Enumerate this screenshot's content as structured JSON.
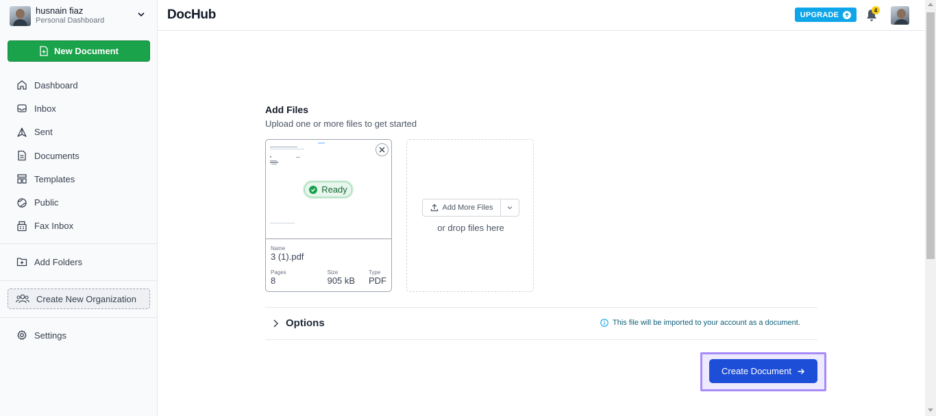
{
  "profile": {
    "name": "husnain fiaz",
    "subtitle": "Personal Dashboard"
  },
  "sidebar": {
    "new_document": "New Document",
    "items": [
      {
        "label": "Dashboard",
        "icon": "home-icon"
      },
      {
        "label": "Inbox",
        "icon": "inbox-icon"
      },
      {
        "label": "Sent",
        "icon": "sent-icon"
      },
      {
        "label": "Documents",
        "icon": "document-icon"
      },
      {
        "label": "Templates",
        "icon": "templates-icon"
      },
      {
        "label": "Public",
        "icon": "globe-icon"
      },
      {
        "label": "Fax Inbox",
        "icon": "fax-icon"
      }
    ],
    "add_folders": "Add Folders",
    "create_org": "Create New Organization",
    "settings": "Settings"
  },
  "header": {
    "logo": "DocHub",
    "upgrade": "UPGRADE",
    "notification_count": "4"
  },
  "main": {
    "title": "Add Files",
    "subtitle": "Upload one or more files to get started",
    "file": {
      "status": "Ready",
      "name_label": "Name",
      "name": "3 (1).pdf",
      "pages_label": "Pages",
      "pages": "8",
      "size_label": "Size",
      "size": "905 kB",
      "type_label": "Type",
      "type": "PDF"
    },
    "dropzone": {
      "add_more": "Add More Files",
      "drop_text": "or drop files here"
    },
    "options_label": "Options",
    "info_text": "This file will be imported to your account as a document.",
    "create_button": "Create Document"
  },
  "colors": {
    "primary_green": "#1aa34a",
    "primary_blue": "#1d4ed8",
    "upgrade_blue": "#0ea5e9",
    "highlight": "#a78bfa"
  }
}
